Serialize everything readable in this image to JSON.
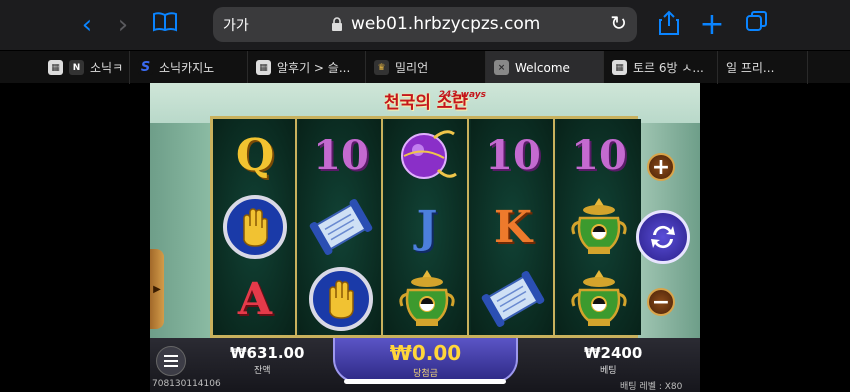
{
  "browser": {
    "address_prefix": "가가",
    "url": "web01.hrbzycpzs.com"
  },
  "tabs": [
    {
      "label": "소닉ㅋ",
      "favicon": "N"
    },
    {
      "label": "소닉카지노",
      "favicon": "S"
    },
    {
      "label": "알후기 > 슬...",
      "favicon": ""
    },
    {
      "label": "밀리언",
      "favicon": ""
    },
    {
      "label": "Welcome",
      "favicon": "×"
    },
    {
      "label": "토르 6방 ㅅ...",
      "favicon": ""
    },
    {
      "label": "일 프리...",
      "favicon": ""
    }
  ],
  "game": {
    "title": "천국의 소란",
    "ways": "243 ways",
    "reels": [
      [
        "Q",
        "hand-icon",
        "A"
      ],
      [
        "10",
        "scroll-icon",
        "hand-icon"
      ],
      [
        "orb-icon",
        "J",
        "urn-icon"
      ],
      [
        "10",
        "K",
        "scroll-icon"
      ],
      [
        "10",
        "urn-icon",
        "urn-icon"
      ]
    ],
    "balance_value": "₩631.00",
    "balance_label": "잔액",
    "win_value": "₩0.00",
    "win_label": "당첨금",
    "bet_value": "₩2400",
    "bet_label": "베팅",
    "game_id": "708130114106",
    "bet_level": "배팅 레벨 : X80"
  },
  "colors": {
    "accent": "#0a84ff",
    "win": "#ffd63a"
  }
}
